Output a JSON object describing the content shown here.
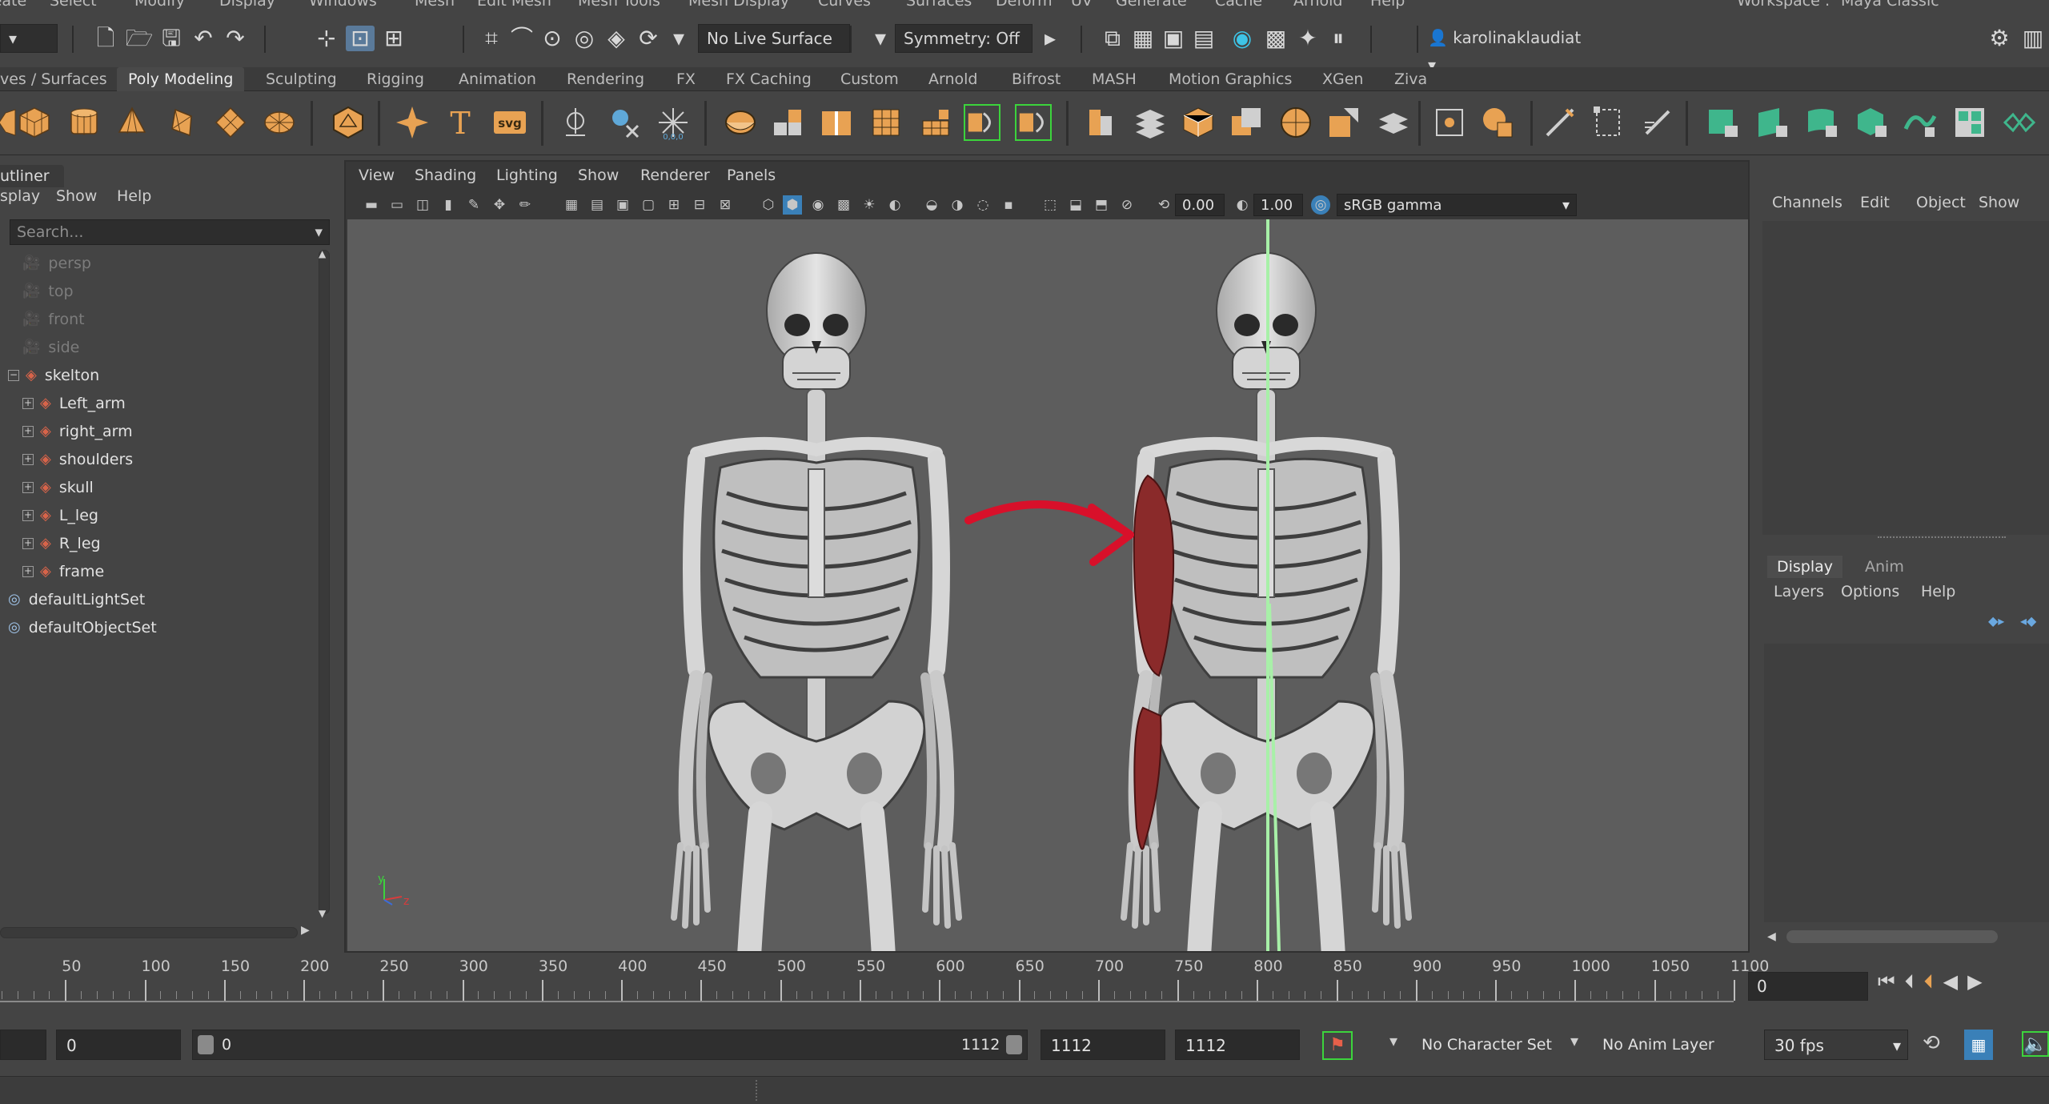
{
  "menubar": {
    "items": [
      "Create",
      "Select",
      "Modify",
      "Display",
      "Windows",
      "Mesh",
      "Edit Mesh",
      "Mesh Tools",
      "Mesh Display",
      "Curves",
      "Surfaces",
      "Deform",
      "UV",
      "Generate",
      "Cache",
      "Arnold",
      "Help"
    ],
    "workspace_label": "Workspace :",
    "workspace_value": "Maya Classic"
  },
  "statusline": {
    "live_surface": "No Live Surface",
    "symmetry": "Symmetry: Off",
    "user": "karolinaklaudiat"
  },
  "shelf_tabs": {
    "items": [
      "ves / Surfaces",
      "Poly Modeling",
      "Sculpting",
      "Rigging",
      "Animation",
      "Rendering",
      "FX",
      "FX Caching",
      "Custom",
      "Arnold",
      "Bifrost",
      "MASH",
      "Motion Graphics",
      "XGen",
      "Ziva"
    ],
    "active": "Poly Modeling"
  },
  "outliner": {
    "title": "utliner",
    "menu": [
      "splay",
      "Show",
      "Help"
    ],
    "search_placeholder": "Search...",
    "items": [
      {
        "label": "persp",
        "kind": "camera",
        "dim": true
      },
      {
        "label": "top",
        "kind": "camera",
        "dim": true
      },
      {
        "label": "front",
        "kind": "camera",
        "dim": true
      },
      {
        "label": "side",
        "kind": "camera",
        "dim": true
      },
      {
        "label": "skelton",
        "kind": "group",
        "dim": false
      },
      {
        "label": "Left_arm",
        "kind": "mesh",
        "dim": false
      },
      {
        "label": "right_arm",
        "kind": "mesh",
        "dim": false
      },
      {
        "label": "shoulders",
        "kind": "mesh",
        "dim": false
      },
      {
        "label": "skull",
        "kind": "mesh",
        "dim": false
      },
      {
        "label": "L_leg",
        "kind": "mesh",
        "dim": false
      },
      {
        "label": "R_leg",
        "kind": "mesh",
        "dim": false
      },
      {
        "label": "frame",
        "kind": "mesh",
        "dim": false
      },
      {
        "label": "defaultLightSet",
        "kind": "set",
        "dim": false
      },
      {
        "label": "defaultObjectSet",
        "kind": "set",
        "dim": false
      }
    ]
  },
  "viewport": {
    "menu": [
      "View",
      "Shading",
      "Lighting",
      "Show",
      "Renderer",
      "Panels"
    ],
    "exposure": "0.00",
    "gamma": "1.00",
    "color_space": "sRGB gamma",
    "axis_y": "y",
    "axis_z": "z"
  },
  "channelbox": {
    "menu": [
      "Channels",
      "Edit",
      "Object",
      "Show"
    ],
    "layer_tabs": [
      "Display",
      "Anim"
    ],
    "layer_menu": [
      "Layers",
      "Options",
      "Help"
    ]
  },
  "timeslider": {
    "ticks": [
      "50",
      "100",
      "150",
      "200",
      "250",
      "300",
      "350",
      "400",
      "450",
      "500",
      "550",
      "600",
      "650",
      "700",
      "750",
      "800",
      "850",
      "900",
      "950",
      "1000",
      "1050",
      "1100"
    ],
    "current_frame": "0"
  },
  "rangeslider": {
    "start": "0",
    "range_start": "0",
    "range_end": "1112",
    "end_a": "1112",
    "end_b": "1112",
    "character_set": "No Character Set",
    "anim_layer": "No Anim Layer",
    "fps": "30 fps"
  },
  "colors": {
    "orange_icons": "#e8a253",
    "green_shelf": "#3fb68c",
    "muscle_red": "#8a2a2a",
    "arrow_red": "#d8102a",
    "grid_green": "#a8f0a8"
  }
}
